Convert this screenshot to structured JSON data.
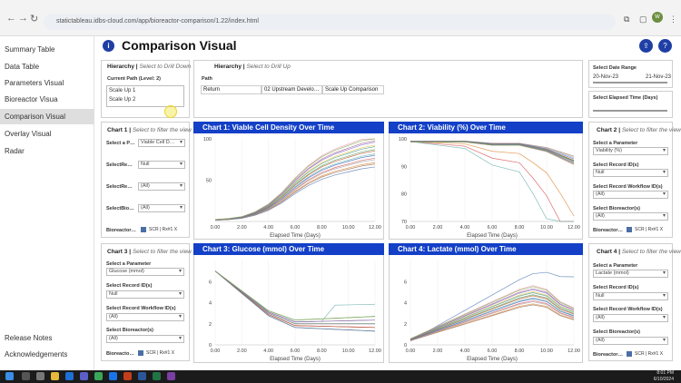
{
  "browser": {
    "url": "statictableau.idbs-cloud.com/app/bioreactor-comparison/1.22/index.html"
  },
  "sidebar": {
    "items": [
      {
        "label": "Summary Table",
        "active": false
      },
      {
        "label": "Data Table",
        "active": false
      },
      {
        "label": "Parameters Visual",
        "active": false
      },
      {
        "label": "Bioreactor Visua",
        "active": false
      },
      {
        "label": "Comparison Visual",
        "active": true
      },
      {
        "label": "Overlay Visual",
        "active": false
      },
      {
        "label": "Radar",
        "active": false
      }
    ],
    "bottom": [
      "Release Notes",
      "Acknowledgements"
    ]
  },
  "header": {
    "title": "Comparison Visual",
    "icon": "i"
  },
  "hier_left": {
    "title": "Hierarchy",
    "hint": "Select to Drill Down",
    "path_label": "Current Path (Level: 2)",
    "items": [
      "Scale Up 1",
      "Scale Up 2"
    ]
  },
  "hier_right": {
    "title": "Hierarchy",
    "hint": "Select to Drill Up",
    "path": "Path",
    "cells": [
      "Return",
      "02 Upstream Develo…",
      "Scale Up Comparison"
    ]
  },
  "date_range": {
    "title": "Select Date Range",
    "start": "20-Nov-23",
    "end": "21-Nov-23"
  },
  "elapsed": {
    "title": "Select Elapsed Time (Days)"
  },
  "filter1": {
    "title": "Chart 1",
    "hint": "Select to filter the view",
    "labels": [
      "Select a P…",
      "SelectRe…",
      "SelectRe…",
      "SelectBio…",
      "Bioreactor…"
    ],
    "values": [
      "Viable Cell D…",
      "Null",
      "(All)",
      "(All)",
      "SCR | Rx#1 X"
    ]
  },
  "filter2": {
    "title": "Chart 2",
    "hint": "Select to filter the view",
    "labels": [
      "Select a Parameter",
      "Select Record ID(s)",
      "Select Record Workflow ID(s)",
      "Select Bioreactor(s)",
      "Bioreactor…"
    ],
    "values": [
      "Viability (%)",
      "Null",
      "(All)",
      "(All)",
      "SCR | Rx#1 X"
    ]
  },
  "filter3": {
    "title": "Chart 3",
    "hint": "Select to filter the view",
    "labels": [
      "Select a Parameter",
      "Select Record ID(s)",
      "Select Record Workflow ID(s)",
      "Select Bioreactor(s)",
      "Bioreacto…"
    ],
    "values": [
      "Glucose (mmol)",
      "Null",
      "(All)",
      "(All)",
      "SCR | Rx#1 X"
    ]
  },
  "filter4": {
    "title": "Chart 4",
    "hint": "Select to filter the view",
    "labels": [
      "Select a Parameter",
      "Select Record ID(s)",
      "Select Record Workflow ID(s)",
      "Select Bioreactor(s)",
      "Bioreactor…"
    ],
    "values": [
      "Lactate (mmol)",
      "Null",
      "(All)",
      "(All)",
      "SCR | Rx#1 X"
    ]
  },
  "colors": {
    "accent": "#1340c7",
    "navy": "#1f3fa6"
  },
  "chart_data": [
    {
      "type": "line",
      "title": "Chart 1:  Viable Cell Density Over Time",
      "xlabel": "Elapsed Time (Days)",
      "ylabel": "",
      "xticks": [
        "0.00",
        "2.00",
        "4.00",
        "6.00",
        "8.00",
        "10.00",
        "12.00"
      ],
      "yticks": [
        "50",
        "100"
      ],
      "xlim": [
        0,
        12
      ],
      "ylim": [
        0,
        100
      ],
      "series_shape": {
        "x": [
          0,
          1,
          2,
          3,
          4,
          5,
          6,
          7,
          8,
          9,
          10,
          11,
          12
        ],
        "y": [
          2,
          3,
          5,
          10,
          18,
          30,
          45,
          58,
          68,
          75,
          80,
          85,
          88
        ]
      }
    },
    {
      "type": "line",
      "title": "Chart 2:  Viability (%) Over Time",
      "xlabel": "Elapsed Time (Days)",
      "ylabel": "",
      "xticks": [
        "0.00",
        "2.00",
        "4.00",
        "6.00",
        "8.00",
        "10.00",
        "12.00"
      ],
      "yticks": [
        "100",
        "90",
        "80",
        "70"
      ],
      "xlim": [
        0,
        12
      ],
      "ylim": [
        70,
        100
      ],
      "series_shape": {
        "x": [
          0,
          2,
          4,
          6,
          8,
          9,
          10,
          11,
          12
        ],
        "y": [
          99,
          99,
          99,
          98,
          98,
          97,
          96,
          94,
          92
        ]
      }
    },
    {
      "type": "line",
      "title": "Chart 3:  Glucose (mmol) Over Time",
      "xlabel": "Elapsed Time (Days)",
      "ylabel": "",
      "xticks": [
        "0.00",
        "2.00",
        "4.00",
        "6.00",
        "8.00",
        "10.00",
        "12.00"
      ],
      "yticks": [
        "0",
        "2",
        "4",
        "6"
      ],
      "xlim": [
        0,
        12
      ],
      "ylim": [
        0,
        8
      ],
      "series_shape": {
        "x": [
          0,
          1,
          2,
          3,
          4,
          5,
          6,
          7,
          8,
          9,
          10,
          11,
          12
        ],
        "y": [
          7,
          6,
          5,
          4,
          3,
          2.5,
          2,
          2,
          2,
          2,
          2,
          2,
          2
        ]
      }
    },
    {
      "type": "line",
      "title": "Chart 4:  Lactate (mmol) Over Time",
      "xlabel": "Elapsed Time (Days)",
      "ylabel": "",
      "xticks": [
        "0.00",
        "2.00",
        "4.00",
        "6.00",
        "8.00",
        "10.00",
        "12.00"
      ],
      "yticks": [
        "0",
        "2",
        "4",
        "6"
      ],
      "xlim": [
        0,
        12
      ],
      "ylim": [
        0,
        8
      ],
      "series_shape": {
        "x": [
          0,
          2,
          4,
          6,
          8,
          9,
          10,
          11,
          12
        ],
        "y": [
          0.5,
          1.5,
          2.5,
          3.5,
          4.5,
          4.8,
          4.5,
          3.5,
          3
        ]
      }
    }
  ],
  "clock": {
    "time": "8:01 PM",
    "date": "6/10/2024"
  }
}
